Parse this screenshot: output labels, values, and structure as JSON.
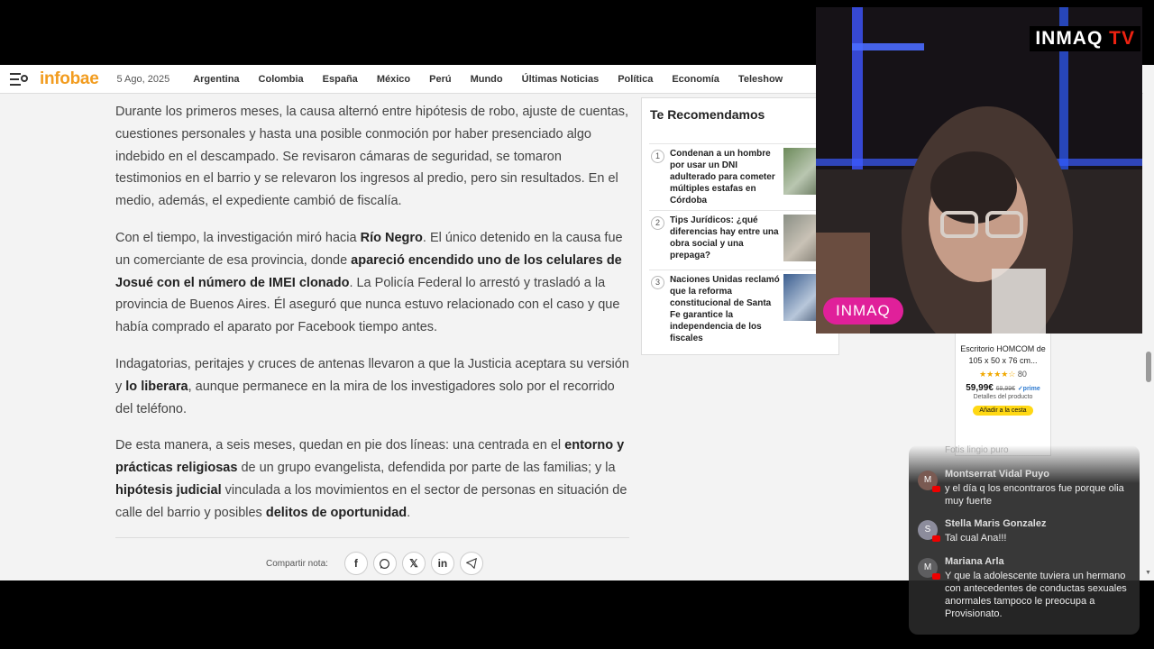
{
  "site": {
    "logo": "infobae",
    "date": "5 Ago, 2025",
    "nav": [
      "Argentina",
      "Colombia",
      "España",
      "México",
      "Perú",
      "Mundo",
      "Últimas Noticias",
      "Política",
      "Economía",
      "Teleshow"
    ]
  },
  "article": {
    "p1": "Durante los primeros meses, la causa alternó entre hipótesis de robo, ajuste de cuentas, cuestiones personales y hasta una posible conmoción por haber presenciado algo indebido en el descampado. Se revisaron cámaras de seguridad, se tomaron testimonios en el barrio y se relevaron los ingresos al predio, pero sin resultados. En el medio, además, el expediente cambió de fiscalía.",
    "p2a": "Con el tiempo, la investigación miró hacia ",
    "p2b": "Río Negro",
    "p2c": ". El único detenido en la causa fue un comerciante de esa provincia, donde ",
    "p2d": "apareció encendido uno de los celulares de Josué con el número de IMEI clonado",
    "p2e": ". La Policía Federal lo arrestó y trasladó a la provincia de Buenos Aires. Él aseguró que nunca estuvo relacionado con el caso y que había comprado el aparato por Facebook tiempo antes.",
    "p3a": "Indagatorias, peritajes y cruces de antenas llevaron a que la Justicia aceptara su versión y ",
    "p3b": "lo liberara",
    "p3c": ", aunque permanece en la mira de los investigadores solo por el recorrido del teléfono.",
    "p4a": "De esta manera, a seis meses, quedan en pie dos líneas: una centrada en el ",
    "p4b": "entorno y prácticas religiosas",
    "p4c": " de un grupo evangelista, defendida por parte de las familias; y la ",
    "p4d": "hipótesis judicial",
    "p4e": " vinculada a los movimientos en el sector de personas en situación de calle del barrio y posibles ",
    "p4f": "delitos de oportunidad",
    "p4g": ".",
    "share_label": "Compartir nota:"
  },
  "recommend": {
    "title": "Te Recomendamos",
    "items": [
      {
        "num": "1",
        "text": "Condenan a un hombre por usar un DNI adulterado para cometer múltiples estafas en Córdoba"
      },
      {
        "num": "2",
        "text": "Tips Jurídicos: ¿qué diferencias hay entre una obra social y una prepaga?"
      },
      {
        "num": "3",
        "text": "Naciones Unidas reclamó que la reforma constitucional de Santa Fe garantice la independencia de los fiscales"
      }
    ]
  },
  "ad": {
    "title": "Escritorio HOMCOM de 105 x 50 x 76 cm...",
    "stars": "★★★★☆",
    "reviews": "80",
    "price": "59,99€",
    "old_price": "69,99€",
    "prime": "✓prime",
    "details": "Detalles del producto",
    "button": "Añadir a la cesta"
  },
  "chat": {
    "faded": "Fotis lingio puro",
    "messages": [
      {
        "initial": "M",
        "name": "Montserrat Vidal Puyo",
        "text": "y el día q los encontraros fue porque olia muy fuerte"
      },
      {
        "initial": "S",
        "name": "Stella Maris Gonzalez",
        "text": "Tal cual Ana!!!"
      },
      {
        "initial": "M",
        "name": "Mariana Arla",
        "text": "Y que la adolescente tuviera un hermano con antecedentes de conductas sexuales anormales tampoco le preocupa a Provisionato."
      }
    ]
  },
  "stream": {
    "brand_a": "INMAQ",
    "brand_b": "TV",
    "logo": "INMAQ"
  }
}
